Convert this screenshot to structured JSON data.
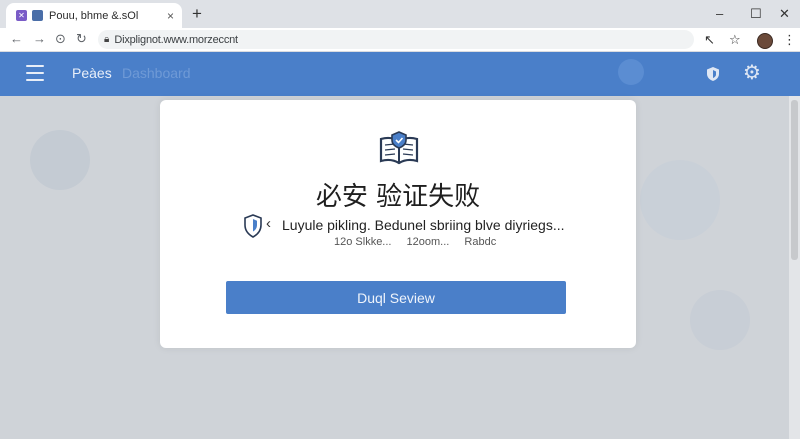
{
  "browser": {
    "tab_title": "Pouu, bhme &.sOl",
    "tab_close": "×",
    "new_tab": "+",
    "url": "Dixplignot.www.morzeccnt",
    "window_controls": {
      "minimize": "–",
      "maximize": "☐",
      "close": "✕"
    }
  },
  "app": {
    "title": "Peàes",
    "title_faded": "Dashboard"
  },
  "dialog": {
    "title": "必安 验证失败",
    "message": "Luyule pikling. Bedunel sbriing blve diyriegs...",
    "meta": [
      "12o Slkke...",
      "12oom...",
      "Rabdc"
    ],
    "button_label": "Duql Seview"
  },
  "colors": {
    "brand_blue": "#4a7fc9",
    "tab_favicon": "#7a5cc7"
  }
}
